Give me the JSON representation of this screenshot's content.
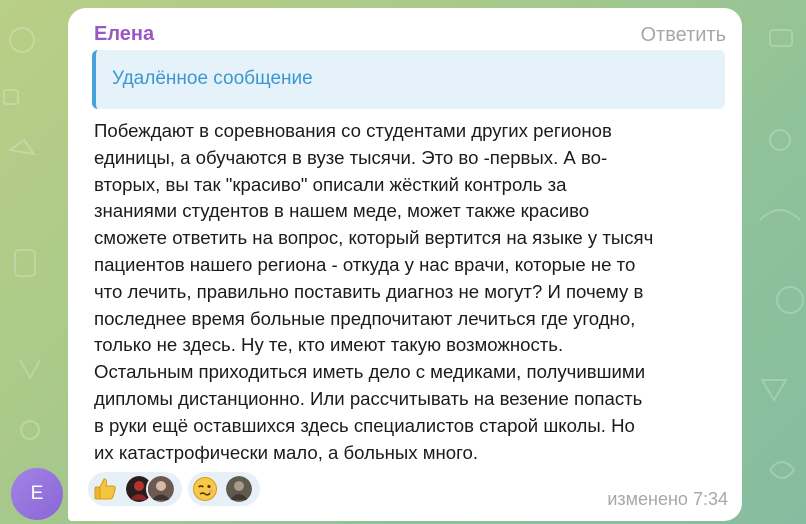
{
  "sender": {
    "name": "Елена",
    "initial": "Е"
  },
  "reply_label": "Ответить",
  "reply_quote": "Удалённое сообщение",
  "message_lines": [
    "Побеждают в соревнования со студентами других регионов",
    "единицы, а обучаются в вузе тысячи. Это во -первых. А во-",
    "вторых, вы так \"красиво\" описали жёсткий контроль за",
    "знаниями студентов в нашем меде,  может также красиво",
    "сможете ответить на вопрос, который вертится на языке у тысяч",
    "пациентов нашего региона - откуда у нас  врачи, которые не то",
    "что лечить, правильно поставить диагноз не могут? И почему в",
    "последнее время  больные предпочитают лечиться где угодно,",
    "только не здесь. Ну те, кто имеют такую возможность.",
    "Остальным приходиться иметь дело с медиками, получившими",
    "дипломы дистанционно. Или рассчитывать на везение попасть",
    "в руки ещё оставшихся здесь  специалистов старой школы. Но",
    "их катастрофически мало, а больных много."
  ],
  "reactions": [
    {
      "emoji": "thumbs-up-icon",
      "reactor_avatars": 2
    },
    {
      "emoji": "woozy-face-icon",
      "reactor_avatars": 1
    }
  ],
  "edited_label": "изменено",
  "time": "7:34",
  "colors": {
    "sender": "#9a57c2",
    "quote_accent": "#46a2da",
    "quote_bg": "#e6f2fa",
    "meta": "#a7a7a7",
    "avatar": "#9574e0"
  }
}
